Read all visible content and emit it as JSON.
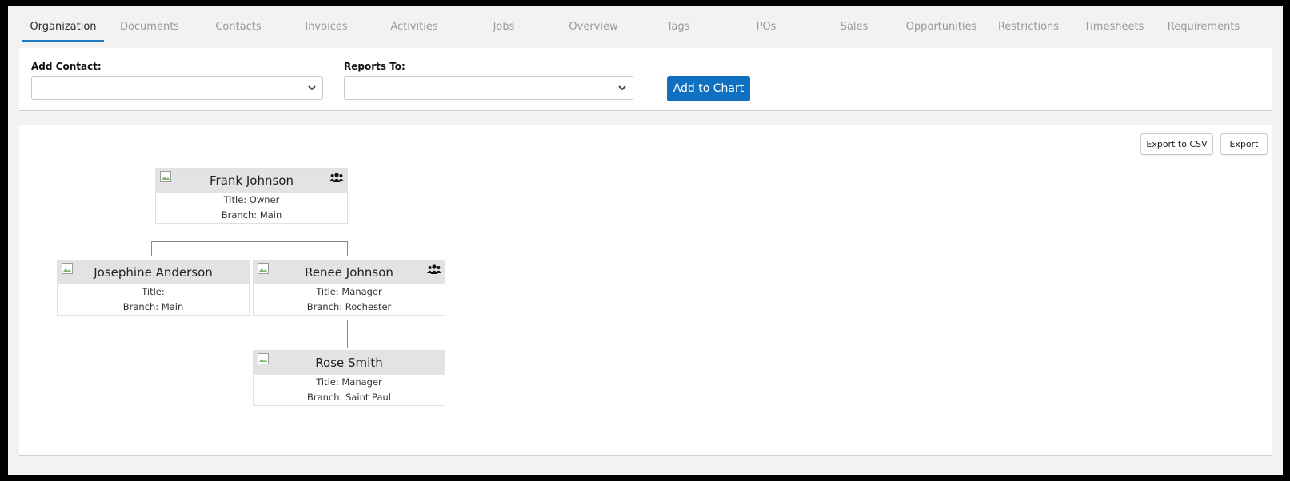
{
  "tabs": [
    {
      "label": "Organization",
      "active": true
    },
    {
      "label": "Documents"
    },
    {
      "label": "Contacts"
    },
    {
      "label": "Invoices"
    },
    {
      "label": "Activities"
    },
    {
      "label": "Jobs"
    },
    {
      "label": "Overview"
    },
    {
      "label": "Tags"
    },
    {
      "label": "POs"
    },
    {
      "label": "Sales"
    },
    {
      "label": "Opportunities"
    },
    {
      "label": "Restrictions"
    },
    {
      "label": "Timesheets"
    },
    {
      "label": "Requirements"
    }
  ],
  "form": {
    "add_contact_label": "Add Contact:",
    "add_contact_value": "",
    "reports_to_label": "Reports To:",
    "reports_to_value": "",
    "add_button": "Add to Chart"
  },
  "chart_actions": {
    "export_csv": "Export to CSV",
    "export": "Export"
  },
  "org": {
    "frank": {
      "name": "Frank Johnson",
      "title": "Title: Owner",
      "branch": "Branch: Main",
      "has_team": true
    },
    "josephine": {
      "name": "Josephine Anderson",
      "title": "Title:",
      "branch": "Branch: Main",
      "has_team": false
    },
    "renee": {
      "name": "Renee Johnson",
      "title": "Title: Manager",
      "branch": "Branch: Rochester",
      "has_team": true
    },
    "rose": {
      "name": "Rose Smith",
      "title": "Title: Manager",
      "branch": "Branch: Saint Paul",
      "has_team": false
    }
  },
  "colors": {
    "accent": "#0f70c2",
    "tab_active_underline": "#1f7bc1",
    "node_header": "#e3e3e3"
  }
}
